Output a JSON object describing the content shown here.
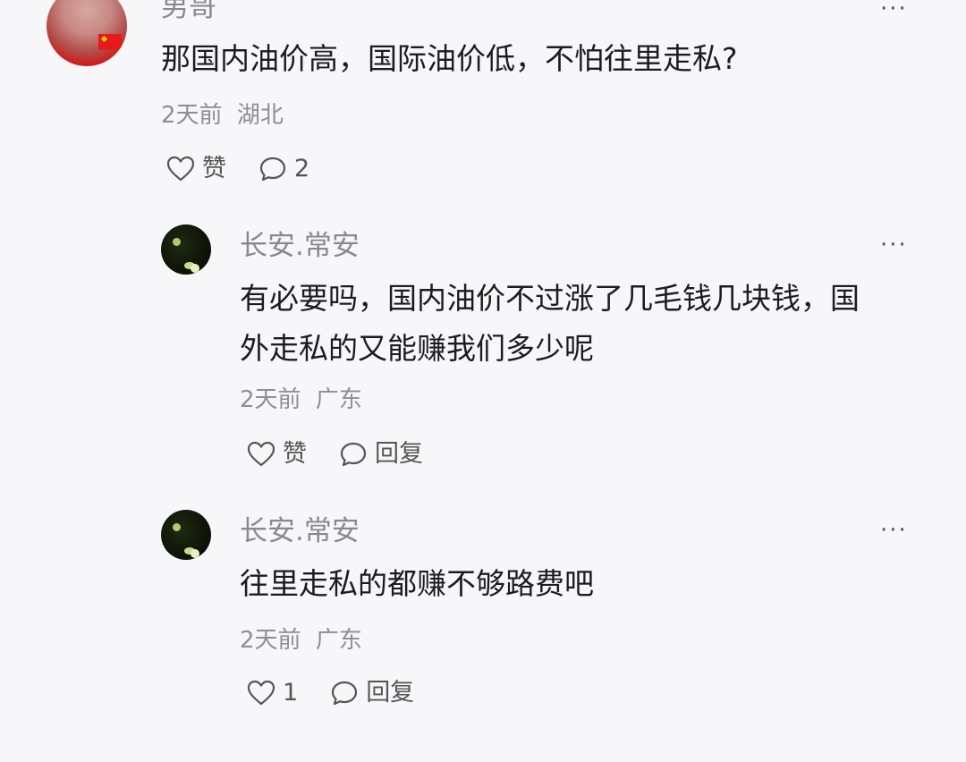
{
  "comments": [
    {
      "username": "男哥",
      "text": "那国内油价高，国际油价低，不怕往里走私?",
      "time": "2天前",
      "location": "湖北",
      "like_label": "赞",
      "reply_label": "2"
    },
    {
      "username": "长安.常安",
      "text": "有必要吗，国内油价不过涨了几毛钱几块钱，国\n外走私的又能赚我们多少呢",
      "time": "2天前",
      "location": "广东",
      "like_label": "赞",
      "reply_label": "回复"
    },
    {
      "username": "长安.常安",
      "text": "往里走私的都赚不够路费吧",
      "time": "2天前",
      "location": "广东",
      "like_label": "1",
      "reply_label": "回复"
    }
  ],
  "more_label": "···",
  "icons": [
    "heart-icon",
    "comment-bubble-icon",
    "more-icon"
  ]
}
